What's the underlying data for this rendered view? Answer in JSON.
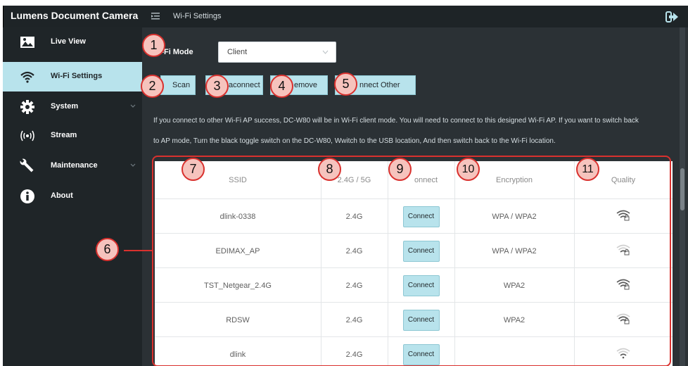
{
  "app": {
    "brand": "Lumens Document Camera",
    "page_title": "Wi-Fi Settings"
  },
  "sidebar": {
    "items": [
      {
        "label": "Live View",
        "icon": "image-icon",
        "active": false,
        "has_chevron": false
      },
      {
        "label": "Wi-Fi Settings",
        "icon": "wifi-icon",
        "active": true,
        "has_chevron": false
      },
      {
        "label": "System",
        "icon": "gear-icon",
        "active": false,
        "has_chevron": true
      },
      {
        "label": "Stream",
        "icon": "broadcast-icon",
        "active": false,
        "has_chevron": false
      },
      {
        "label": "Maintenance",
        "icon": "wrench-icon",
        "active": false,
        "has_chevron": true
      },
      {
        "label": "About",
        "icon": "info-icon",
        "active": false,
        "has_chevron": false
      }
    ]
  },
  "wifi_mode": {
    "label": "Wi-Fi Mode",
    "selected": "Client"
  },
  "buttons": {
    "scan": "Scan",
    "disconnect": "aconnect",
    "remove": "emove",
    "connect_other": "nnect Other"
  },
  "description": {
    "line1": "If you connect to other Wi-Fi AP success, DC-W80 will be in Wi-Fi client mode. You will need to connect to this designed Wi-Fi AP. If you want to switch back",
    "line2": "to AP mode, Turn the black toggle switch on the DC-W80, Wwitch to the USB location, And then switch back to the Wi-Fi location."
  },
  "table": {
    "headers": {
      "ssid": "SSID",
      "band": "2.4G / 5G",
      "connect": "onnect",
      "encryption": "Encryption",
      "quality": "Quality"
    },
    "rows": [
      {
        "ssid": "dlink-0338",
        "band": "2.4G",
        "connect": "Connect",
        "encryption": "WPA / WPA2",
        "quality_bars": 3,
        "locked": true
      },
      {
        "ssid": "EDIMAX_AP",
        "band": "2.4G",
        "connect": "Connect",
        "encryption": "WPA / WPA2",
        "quality_bars": 1,
        "locked": true
      },
      {
        "ssid": "TST_Netgear_2.4G",
        "band": "2.4G",
        "connect": "Connect",
        "encryption": "WPA2",
        "quality_bars": 3,
        "locked": true
      },
      {
        "ssid": "RDSW",
        "band": "2.4G",
        "connect": "Connect",
        "encryption": "WPA2",
        "quality_bars": 2,
        "locked": true
      },
      {
        "ssid": "dlink",
        "band": "2.4G",
        "connect": "Connect",
        "encryption": "",
        "quality_bars": 1,
        "locked": false
      }
    ]
  },
  "callouts": [
    "1",
    "2",
    "3",
    "4",
    "5",
    "6",
    "7",
    "8",
    "9",
    "10",
    "11"
  ],
  "colors": {
    "accent": "#b8e3ec",
    "sidebar_bg": "#1f2528",
    "main_bg": "#2b3135",
    "callout_border": "#d9312e",
    "callout_fill": "#f6c3bd"
  }
}
